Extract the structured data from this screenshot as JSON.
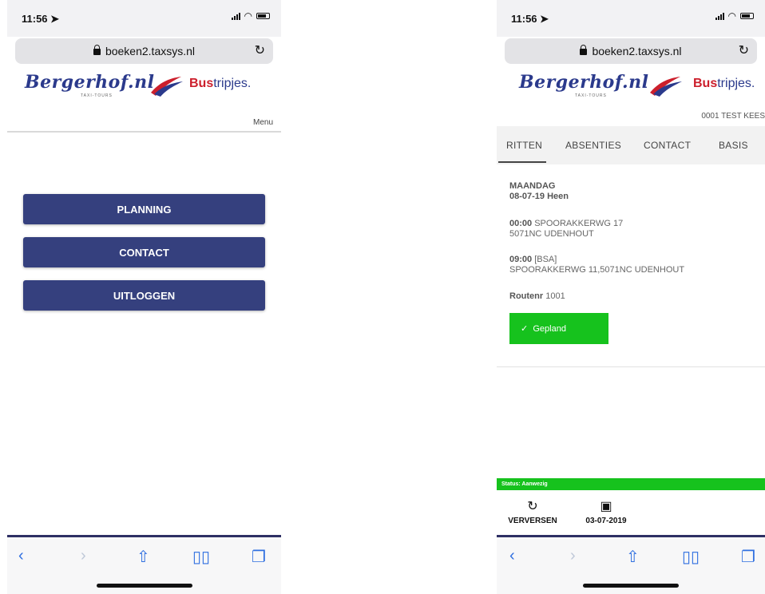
{
  "left": {
    "status": {
      "time": "11:56"
    },
    "url": "boeken2.taxsys.nl",
    "brand": {
      "script": "Bergerhof.nl",
      "sub": "TAXI-TOURS",
      "bus_bold": "Bus",
      "bus_rest": "tripjes."
    },
    "menu_label": "Menu",
    "buttons": [
      "PLANNING",
      "CONTACT",
      "UITLOGGEN"
    ]
  },
  "right": {
    "status": {
      "time": "11:56"
    },
    "url": "boeken2.taxsys.nl",
    "brand": {
      "script": "Bergerhof.nl",
      "sub": "TAXI-TOURS",
      "bus_bold": "Bus",
      "bus_rest": "tripjes."
    },
    "user": "0001 TEST KEES",
    "tabs": [
      "RITTEN",
      "ABSENTIES",
      "CONTACT",
      "BASIS"
    ],
    "ride": {
      "day": "MAANDAG",
      "date_line": "08-07-19 Heen",
      "stop1_time": "00:00",
      "stop1_addr": "SPOORAKKERWG 17",
      "stop1_city": "5071NC UDENHOUT",
      "stop2_time": "09:00",
      "stop2_code": "[BSA]",
      "stop2_addr": "SPOORAKKERWG 11,5071NC UDENHOUT",
      "route_label": "Routenr",
      "route_value": "1001",
      "status_button": "Gepland"
    },
    "status_strip": "Status: Aanwezig",
    "actions": {
      "refresh": "VERVERSEN",
      "date": "03-07-2019"
    }
  },
  "colors": {
    "nav_button": "#35407e",
    "green": "#16c21d",
    "safari_blue": "#2f6fe0",
    "brand_blue": "#2b3a8c",
    "brand_red": "#cc1f2c"
  },
  "icons": [
    "location-arrow-icon",
    "signal-icon",
    "wifi-icon",
    "battery-icon",
    "lock-icon",
    "reload-icon",
    "back-icon",
    "forward-icon",
    "share-icon",
    "bookmarks-icon",
    "tabs-icon",
    "refresh-icon",
    "calendar-icon",
    "check-icon"
  ]
}
